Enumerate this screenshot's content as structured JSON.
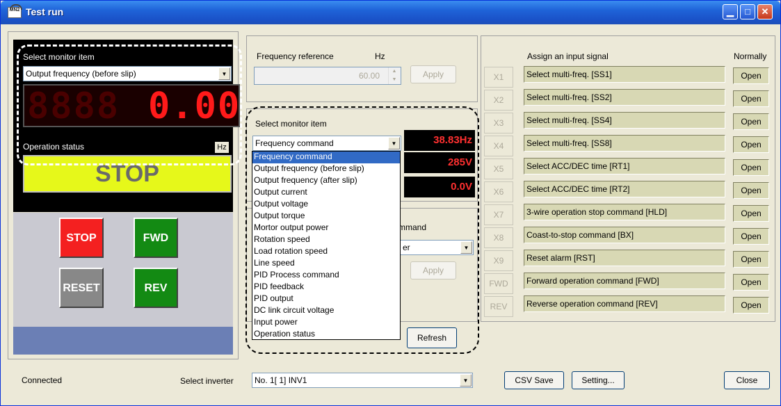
{
  "window": {
    "title": "Test run",
    "app_icon_text": "MN2"
  },
  "left": {
    "select_monitor_label": "Select monitor item",
    "monitor_selected": "Output frequency (before slip)",
    "seg_ghost": "8888",
    "seg_value": "0.00",
    "operation_status_label": "Operation status",
    "unit": "Hz",
    "status": "STOP",
    "buttons": {
      "stop": "STOP",
      "fwd": "FWD",
      "reset": "RESET",
      "rev": "REV"
    }
  },
  "freq": {
    "label": "Frequency reference",
    "unit": "Hz",
    "value": "60.00",
    "apply": "Apply"
  },
  "monitor2": {
    "label": "Select monitor item",
    "selected": "Frequency command",
    "readouts": [
      "38.83Hz",
      "285V",
      "0.0V"
    ],
    "options": [
      "Frequency command",
      "Output frequency (before slip)",
      "Output frequency (after slip)",
      "Output current",
      "Output voltage",
      "Output torque",
      "Mortor output power",
      "Rotation speed",
      "Load rotation speed",
      "Line speed",
      "PID Process command",
      "PID feedback",
      "PID output",
      "DC link circuit voltage",
      "Input power",
      "Operation status"
    ]
  },
  "run_cmd": {
    "label_partial": "mmand",
    "value_partial": "er",
    "apply": "Apply",
    "refresh": "Refresh"
  },
  "signals": {
    "header": "Assign an input signal",
    "normally": "Normally",
    "rows": [
      {
        "term": "X1",
        "signal": "Select multi-freq. [SS1]",
        "state": "Open"
      },
      {
        "term": "X2",
        "signal": "Select multi-freq. [SS2]",
        "state": "Open"
      },
      {
        "term": "X3",
        "signal": "Select multi-freq. [SS4]",
        "state": "Open"
      },
      {
        "term": "X4",
        "signal": "Select multi-freq. [SS8]",
        "state": "Open"
      },
      {
        "term": "X5",
        "signal": "Select ACC/DEC time [RT1]",
        "state": "Open"
      },
      {
        "term": "X6",
        "signal": "Select ACC/DEC time [RT2]",
        "state": "Open"
      },
      {
        "term": "X7",
        "signal": "3-wire operation stop command [HLD]",
        "state": "Open"
      },
      {
        "term": "X8",
        "signal": "Coast-to-stop command [BX]",
        "state": "Open"
      },
      {
        "term": "X9",
        "signal": "Reset alarm [RST]",
        "state": "Open"
      },
      {
        "term": "FWD",
        "signal": "Forward operation command [FWD]",
        "state": "Open"
      },
      {
        "term": "REV",
        "signal": "Reverse operation command [REV]",
        "state": "Open"
      }
    ]
  },
  "footer": {
    "status": "Connected",
    "select_inverter_label": "Select inverter",
    "inverter": "No. 1[ 1] INV1",
    "csv_save": "CSV Save",
    "setting": "Setting...",
    "close": "Close"
  }
}
